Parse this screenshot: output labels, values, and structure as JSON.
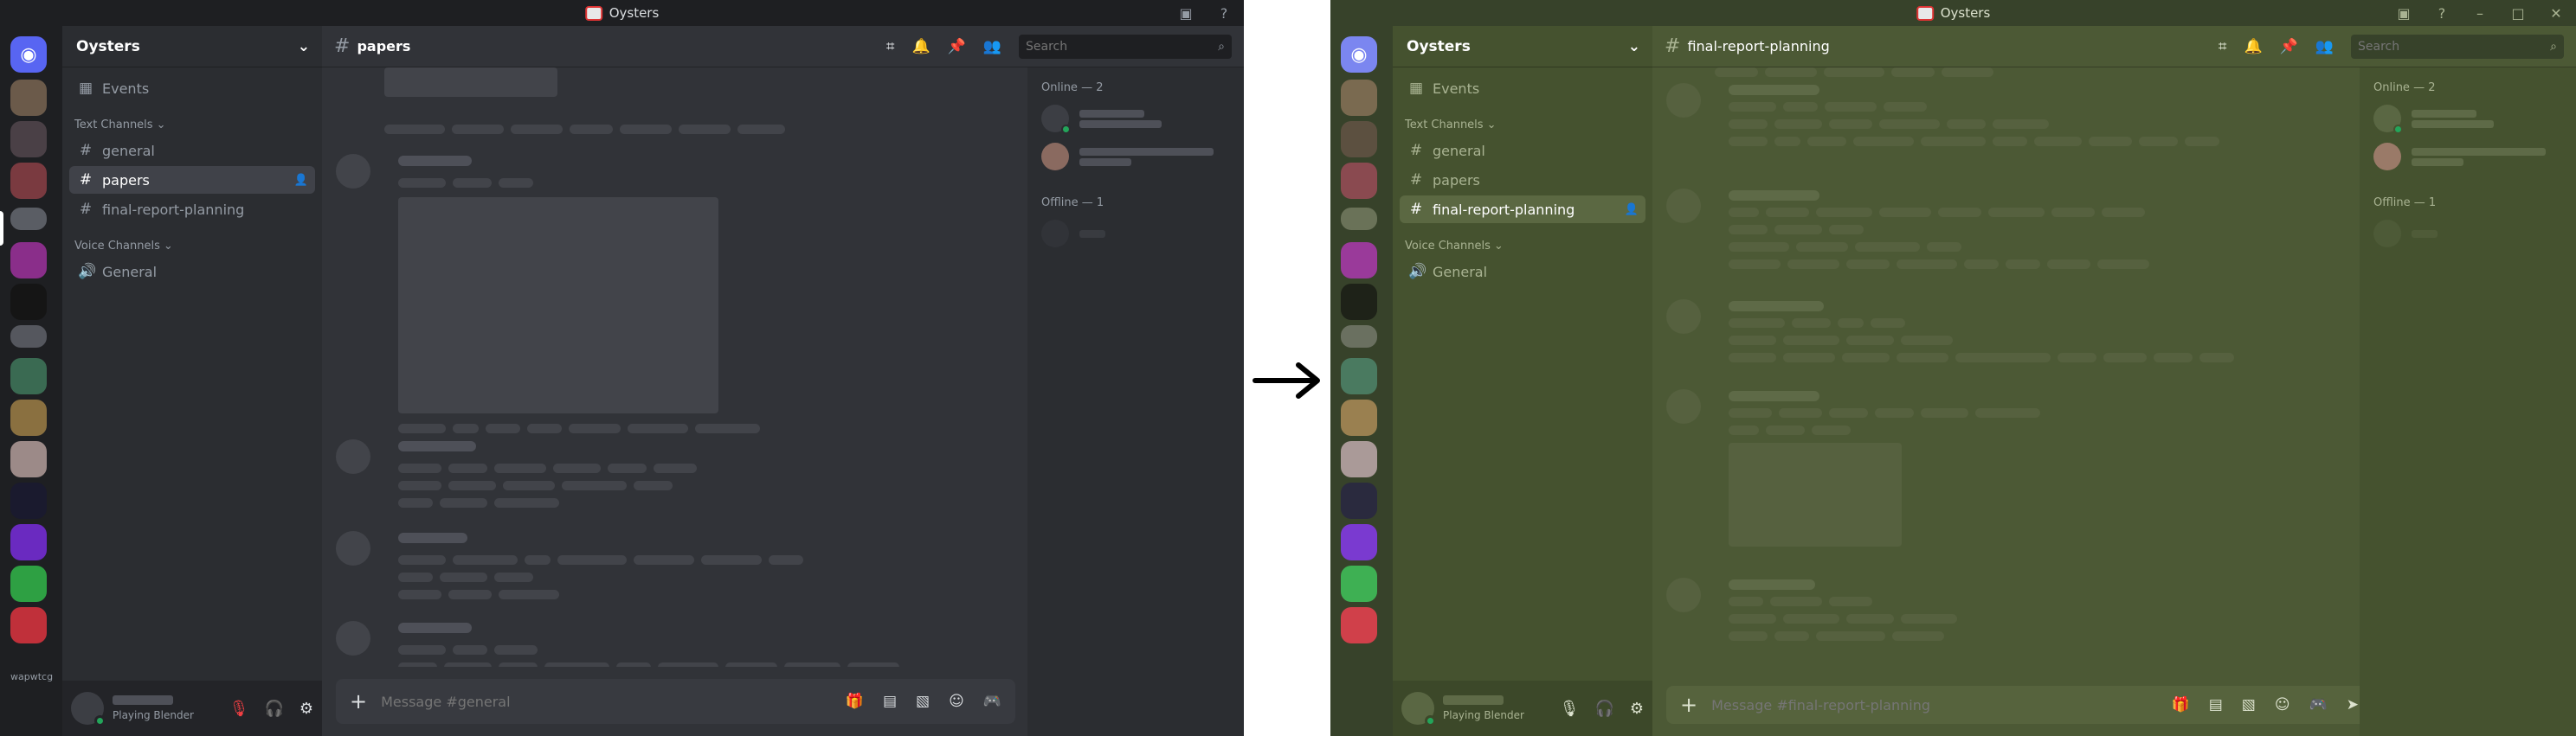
{
  "left": {
    "window_title": "Oysters",
    "server_name": "Oysters",
    "events_label": "Events",
    "text_channels_label": "Text Channels",
    "voice_channels_label": "Voice Channels",
    "channels": [
      "general",
      "papers",
      "final-report-planning"
    ],
    "voice_channel": "General",
    "active_channel": "papers",
    "search_placeholder": "Search",
    "composer_placeholder": "Message #general",
    "online_label": "Online — 2",
    "offline_label": "Offline — 1",
    "user_status": "Playing Blender",
    "rail_label": "wapwtcg"
  },
  "right": {
    "window_title": "Oysters",
    "server_name": "Oysters",
    "events_label": "Events",
    "text_channels_label": "Text Channels",
    "voice_channels_label": "Voice Channels",
    "channels": [
      "general",
      "papers",
      "final-report-planning"
    ],
    "voice_channel": "General",
    "active_channel": "final-report-planning",
    "search_placeholder": "Search",
    "composer_placeholder": "Message #final-report-planning",
    "online_label": "Online — 2",
    "offline_label": "Offline — 1",
    "user_status": "Playing Blender"
  },
  "icons": {
    "hash": "#",
    "threads": "threads-icon",
    "bell": "bell-icon",
    "pin": "pin-icon",
    "members": "members-icon",
    "search": "search-icon",
    "plus": "plus-icon",
    "gift": "gift-icon",
    "gif": "gif-icon",
    "sticker": "sticker-icon",
    "emoji": "emoji-icon",
    "game": "game-icon",
    "mic": "mic-icon",
    "headphones": "headphones-icon",
    "gear": "gear-icon",
    "arrow": "right-arrow-icon"
  },
  "colors": {
    "left_theme": "#313338",
    "right_theme": "#4c5935",
    "blurple": "#5865f2",
    "online_green": "#23a55a",
    "mute_red": "#f23f43"
  }
}
